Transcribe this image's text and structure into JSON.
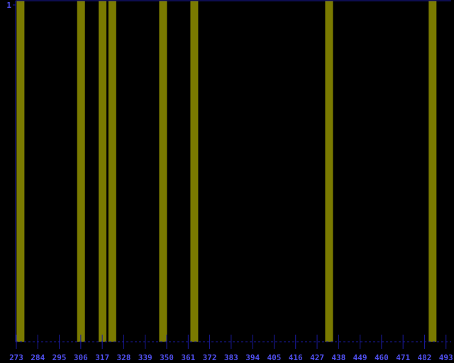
{
  "colors": {
    "background": "#000000",
    "axis": "#1a1aa0",
    "tick_text": "#5050f0",
    "bar": "#7a7a00"
  },
  "chart_data": {
    "type": "bar",
    "title": "",
    "xlabel": "",
    "ylabel": "",
    "xlim": [
      273,
      496
    ],
    "ylim": [
      0,
      1
    ],
    "y_ticks": [
      "1"
    ],
    "x_ticks": [
      273,
      284,
      295,
      306,
      317,
      328,
      339,
      350,
      361,
      372,
      383,
      394,
      405,
      416,
      427,
      438,
      449,
      460,
      471,
      482,
      493
    ],
    "bars": [
      {
        "x": 275.5,
        "value": 1
      },
      {
        "x": 306.5,
        "value": 1
      },
      {
        "x": 317.5,
        "value": 1
      },
      {
        "x": 322.5,
        "value": 1
      },
      {
        "x": 348.5,
        "value": 1
      },
      {
        "x": 364.5,
        "value": 1
      },
      {
        "x": 433.5,
        "value": 1
      },
      {
        "x": 486.5,
        "value": 1
      }
    ],
    "grid": false,
    "legend": "none"
  }
}
